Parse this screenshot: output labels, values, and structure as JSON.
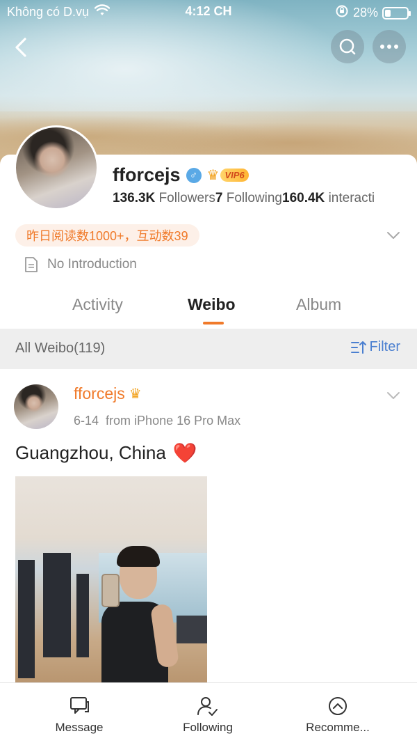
{
  "status_bar": {
    "carrier": "Không có D.vụ",
    "time": "4:12 CH",
    "battery": "28%",
    "battery_level": 0.28
  },
  "profile": {
    "name": "fforcejs",
    "vip_label": "VIP6",
    "followers_count": "136.3K",
    "followers_label": "Followers",
    "following_count": "7",
    "following_label": "Following",
    "interactions_count": "160.4K",
    "interactions_label": "interacti",
    "reads_summary": "昨日阅读数1000+，互动数39",
    "introduction": "No Introduction"
  },
  "tabs": [
    {
      "label": "Activity",
      "active": false
    },
    {
      "label": "Weibo",
      "active": true
    },
    {
      "label": "Album",
      "active": false
    }
  ],
  "filter_bar": {
    "count_label": "All Weibo(119)",
    "filter_label": "Filter"
  },
  "post": {
    "author": "fforcejs",
    "date": "6-14",
    "source": "from iPhone 16 Pro Max",
    "text": "Guangzhou, China",
    "emoji": "❤️"
  },
  "bottom_bar": [
    {
      "label": "Message",
      "icon": "message-icon"
    },
    {
      "label": "Following",
      "icon": "following-icon"
    },
    {
      "label": "Recomme...",
      "icon": "recommend-icon"
    }
  ],
  "colors": {
    "accent": "#f07a2a",
    "link": "#4a7fd0",
    "male_badge": "#5aa9e6"
  }
}
